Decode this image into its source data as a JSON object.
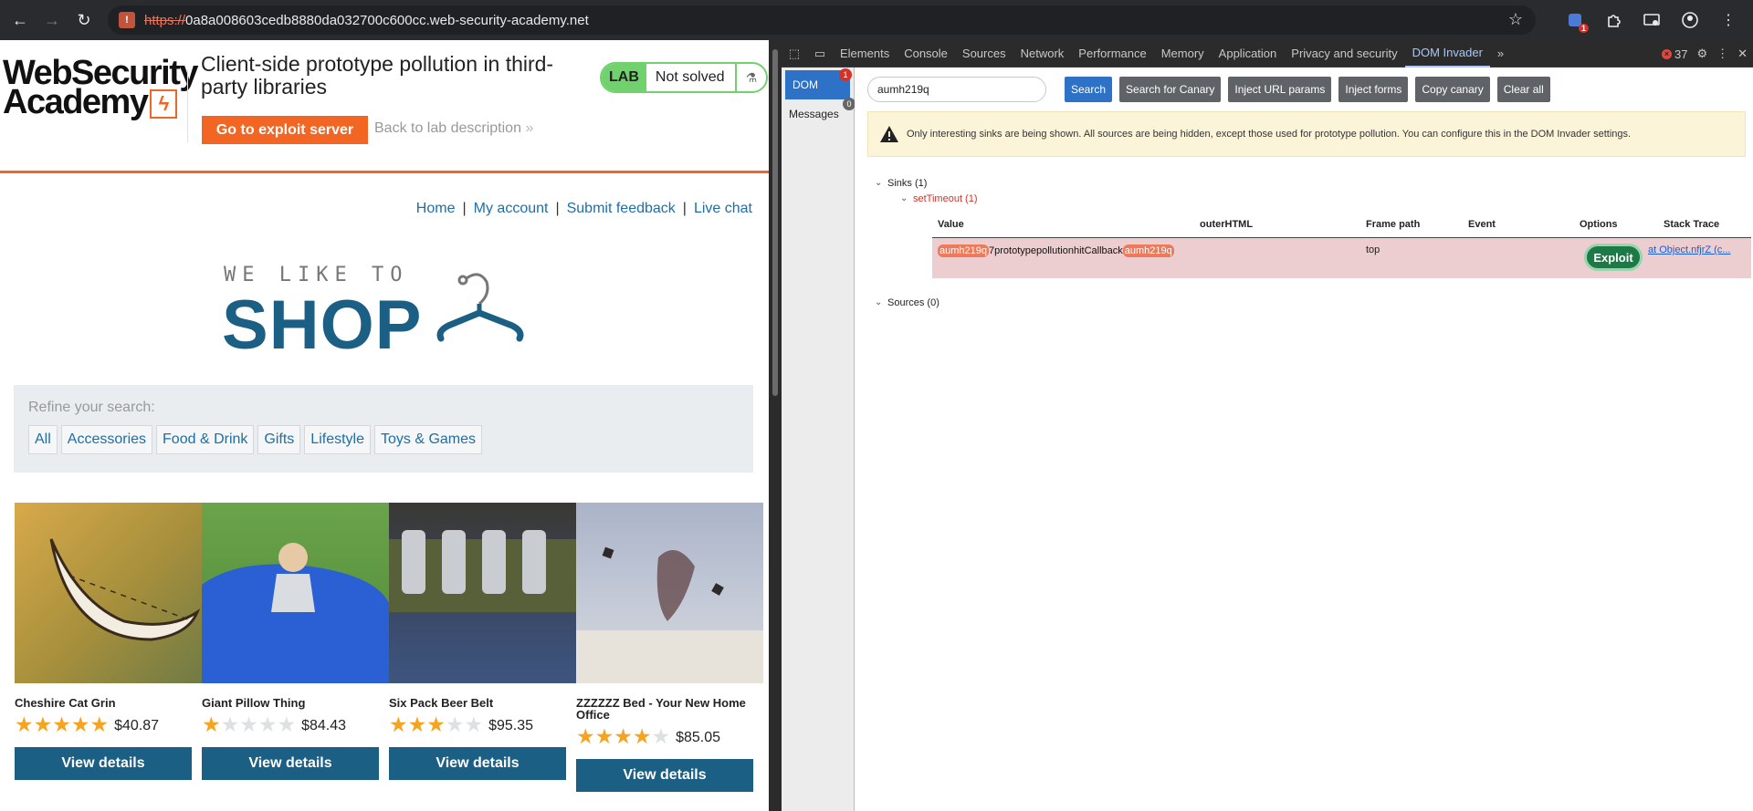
{
  "browser": {
    "url_scheme": "https://",
    "url_rest": "0a8a008603cedb8880da032700c600cc.web-security-academy.net",
    "extension_badge": "1",
    "icons": [
      "back-icon",
      "forward-icon",
      "reload-icon",
      "site-info-icon",
      "star-icon",
      "extension-icon",
      "puzzle-icon",
      "cast-icon",
      "profile-icon",
      "menu-icon"
    ]
  },
  "lab": {
    "logo_line1": "WebSecurity",
    "logo_line2": "Academy",
    "title": "Client-side prototype pollution in third-party libraries",
    "exploit_button": "Go to exploit server",
    "back_link": "Back to lab description",
    "back_link_chevron": "»",
    "badge": "LAB",
    "status": "Not solved",
    "accent_color": "#f26522",
    "solved_color": "#70d16d"
  },
  "shop": {
    "nav": [
      "Home",
      "My account",
      "Submit feedback",
      "Live chat"
    ],
    "nav_separator": "|",
    "logo_small": "WE LIKE TO",
    "logo_big": "SHOP",
    "refine_label": "Refine your search:",
    "filters": [
      "All",
      "Accessories",
      "Food & Drink",
      "Gifts",
      "Lifestyle",
      "Toys & Games"
    ],
    "products": [
      {
        "name": "Cheshire Cat Grin",
        "rating": 5,
        "price": "$40.87",
        "button": "View details"
      },
      {
        "name": "Giant Pillow Thing",
        "rating": 1,
        "price": "$84.43",
        "button": "View details"
      },
      {
        "name": "Six Pack Beer Belt",
        "rating": 3,
        "price": "$95.35",
        "button": "View details"
      },
      {
        "name": "ZZZZZZ Bed - Your New Home Office",
        "rating": 4,
        "price": "$85.05",
        "button": "View details"
      }
    ],
    "brand_color": "#1c5f84"
  },
  "devtools": {
    "tabs": [
      "Elements",
      "Console",
      "Sources",
      "Network",
      "Performance",
      "Memory",
      "Application",
      "Privacy and security",
      "DOM Invader"
    ],
    "active_tab": "DOM Invader",
    "more_tabs": "»",
    "error_count": "37",
    "sidebar": {
      "dom_label": "DOM",
      "dom_count": "1",
      "messages_label": "Messages",
      "messages_count": "0"
    },
    "search_value": "aumh219q",
    "buttons": [
      "Search",
      "Search for Canary",
      "Inject URL params",
      "Inject forms",
      "Copy canary",
      "Clear all"
    ],
    "notice": "Only interesting sinks are being shown. All sources are being hidden, except those used for prototype pollution. You can configure this in the DOM Invader settings.",
    "sinks_label": "Sinks (1)",
    "sink_type": "setTimeout (1)",
    "columns": [
      "Value",
      "outerHTML",
      "Frame path",
      "Event",
      "Options",
      "Stack Trace"
    ],
    "row": {
      "canary_prefix": "aumh219q",
      "value_middle": "7prototypepollutionhitCallback",
      "canary_suffix": "aumh219q",
      "frame_path": "top",
      "option_button": "Exploit",
      "stack_trace": "at Object.nfjrZ (c..."
    },
    "sources_label": "Sources (0)"
  }
}
